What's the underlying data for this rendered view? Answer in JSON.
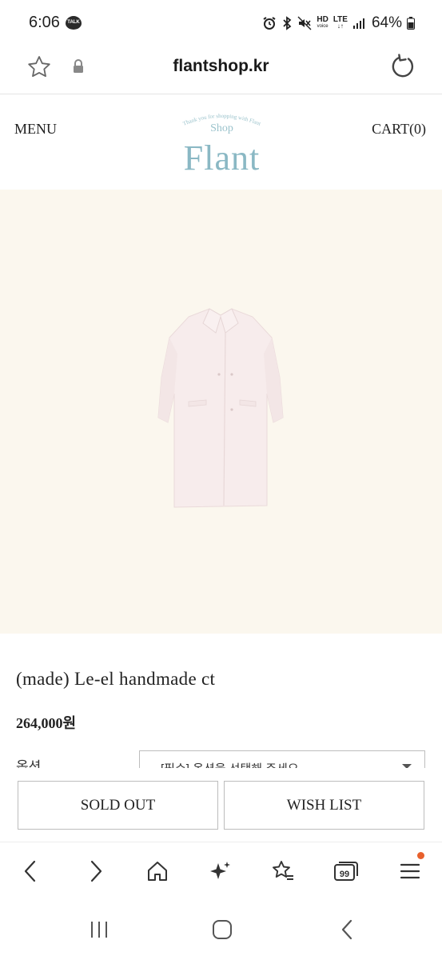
{
  "status": {
    "time": "6:06",
    "talk_badge": "TALK",
    "hd_top": "HD",
    "hd_bottom": "voice",
    "lte_top": "LTE",
    "battery": "64%"
  },
  "browser": {
    "url": "flantshop.kr"
  },
  "header": {
    "menu_label": "MENU",
    "cart_label": "CART(0)",
    "logo_arc_text": "Thank you for shopping with Flant",
    "logo_shop": "Shop",
    "logo_main": "Flant"
  },
  "product": {
    "name": "(made) Le-el handmade ct",
    "price": "264,000원",
    "option_label": "옵션",
    "option_placeholder": "[필수] 옵션을 선택해 주세요"
  },
  "actions": {
    "soldout_label": "SOLD OUT",
    "wishlist_label": "WISH LIST"
  },
  "browser_nav": {
    "tabs_count": "99"
  },
  "colors": {
    "image_bg": "#fbf7ee",
    "logo_color": "#8ab8c4",
    "notification_dot": "#e8602c"
  }
}
